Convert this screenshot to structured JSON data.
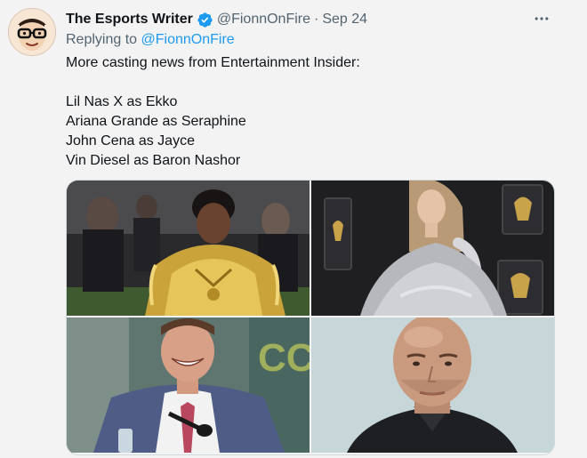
{
  "author": {
    "name": "The Esports Writer",
    "handle": "@FionnOnFire",
    "date": "Sep 24",
    "verified": true,
    "avatar_icon": "cartoon-glasses-avatar"
  },
  "replying": {
    "prefix": "Replying to ",
    "handle": "@FionnOnFire"
  },
  "text": {
    "intro": "More casting news from Entertainment Insider:",
    "lines": [
      "Lil Nas X as Ekko",
      "Ariana Grande as Seraphine",
      "John Cena as Jayce",
      "Vin Diesel as Baron Nashor"
    ]
  },
  "menu_icon": "more-horizontal-icon",
  "colors": {
    "link": "#1d9bf0",
    "muted": "#536471",
    "text": "#0f1419",
    "verified": "#1d9bf0"
  },
  "photos": [
    {
      "subject": "gold armor portrait",
      "icon": "photo-1"
    },
    {
      "subject": "grey gown portrait",
      "icon": "photo-2"
    },
    {
      "subject": "smiling man with microphone",
      "icon": "photo-3"
    },
    {
      "subject": "bald man portrait",
      "icon": "photo-4"
    }
  ]
}
